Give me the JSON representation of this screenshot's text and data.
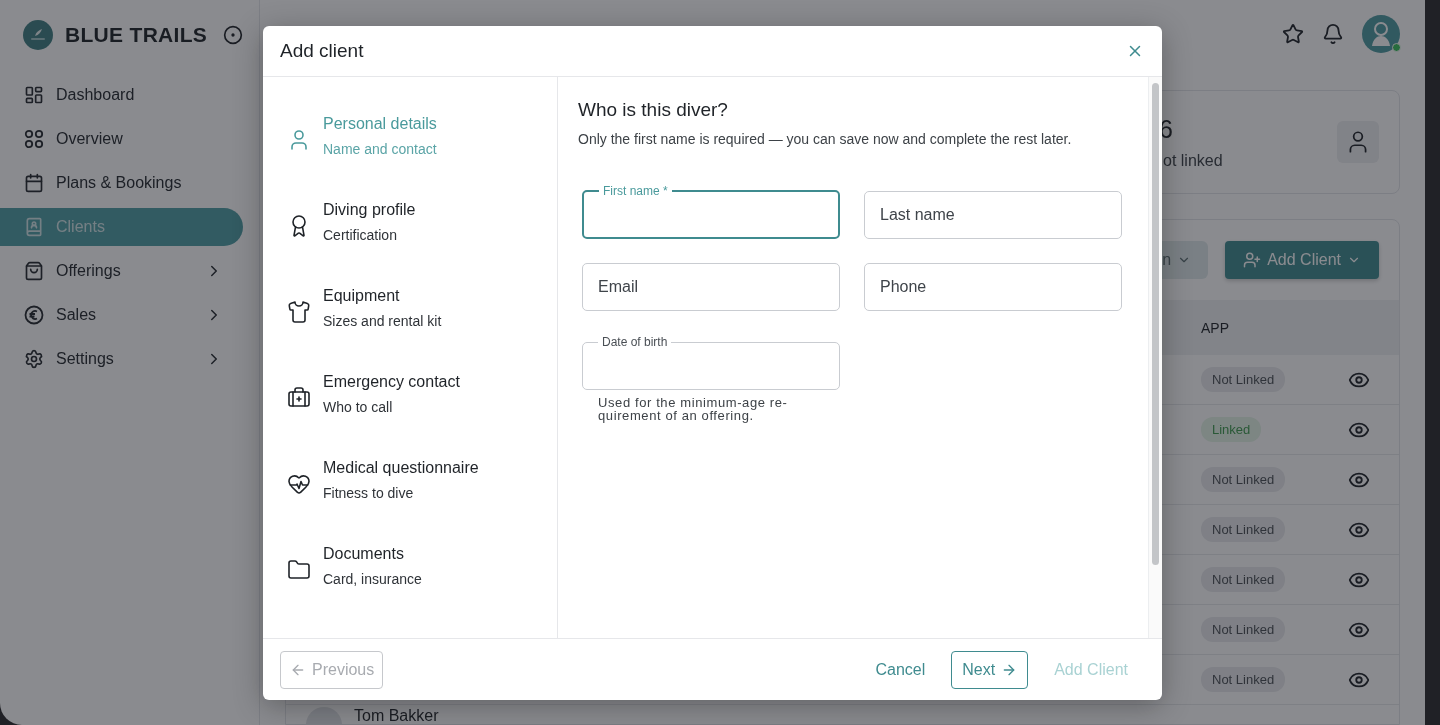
{
  "sidebar": {
    "brand": "BLUE TRAILS",
    "items": [
      {
        "label": "Dashboard",
        "selected": false,
        "expandable": false
      },
      {
        "label": "Overview",
        "selected": false,
        "expandable": false
      },
      {
        "label": "Plans & Bookings",
        "selected": false,
        "expandable": false
      },
      {
        "label": "Clients",
        "selected": true,
        "expandable": false
      },
      {
        "label": "Offerings",
        "selected": false,
        "expandable": true
      },
      {
        "label": "Sales",
        "selected": false,
        "expandable": true
      },
      {
        "label": "Settings",
        "selected": false,
        "expandable": true
      }
    ]
  },
  "stat_card": {
    "value": "6",
    "label": "ot linked"
  },
  "toolbar": {
    "filter_button": "n",
    "add_button": "Add Client"
  },
  "table": {
    "columns": [
      "APP"
    ],
    "rows": [
      {
        "app": {
          "label": "Not Linked",
          "linked": false
        }
      },
      {
        "app": {
          "label": "Linked",
          "linked": true
        }
      },
      {
        "app": {
          "label": "Not Linked",
          "linked": false
        }
      },
      {
        "app": {
          "label": "Not Linked",
          "linked": false
        }
      },
      {
        "app": {
          "label": "Not Linked",
          "linked": false
        }
      },
      {
        "app": {
          "label": "Not Linked",
          "linked": false
        }
      },
      {
        "app": {
          "label": "Not Linked",
          "linked": false
        }
      },
      {
        "name": "Tom Bakker"
      }
    ]
  },
  "dialog": {
    "title": "Add client",
    "steps": [
      {
        "title": "Personal details",
        "subtitle": "Name and contact",
        "selected": true
      },
      {
        "title": "Diving profile",
        "subtitle": "Certification",
        "selected": false
      },
      {
        "title": "Equipment",
        "subtitle": "Sizes and rental kit",
        "selected": false
      },
      {
        "title": "Emergency contact",
        "subtitle": "Who to call",
        "selected": false
      },
      {
        "title": "Medical questionnaire",
        "subtitle": "Fitness to dive",
        "selected": false
      },
      {
        "title": "Documents",
        "subtitle": "Card, insurance",
        "selected": false
      }
    ],
    "heading": "Who is this diver?",
    "intro": "Only the first name is required — you can save now and complete the rest later.",
    "fields": [
      {
        "label": "First name *",
        "focused": true
      },
      {
        "placeholder": "Last name",
        "focused": false
      },
      {
        "placeholder": "Email",
        "focused": false
      },
      {
        "placeholder": "Phone",
        "focused": false
      },
      {
        "label": "Date of birth",
        "focused": false,
        "helper": "Used for the minimum-age re-quirement of an offering."
      }
    ],
    "footer": {
      "previous": {
        "label": "Previous",
        "disabled": true
      },
      "cancel": "Cancel",
      "next": {
        "label": "Next",
        "disabled": false
      },
      "submit": {
        "label": "Add Client",
        "disabled": true
      }
    }
  }
}
